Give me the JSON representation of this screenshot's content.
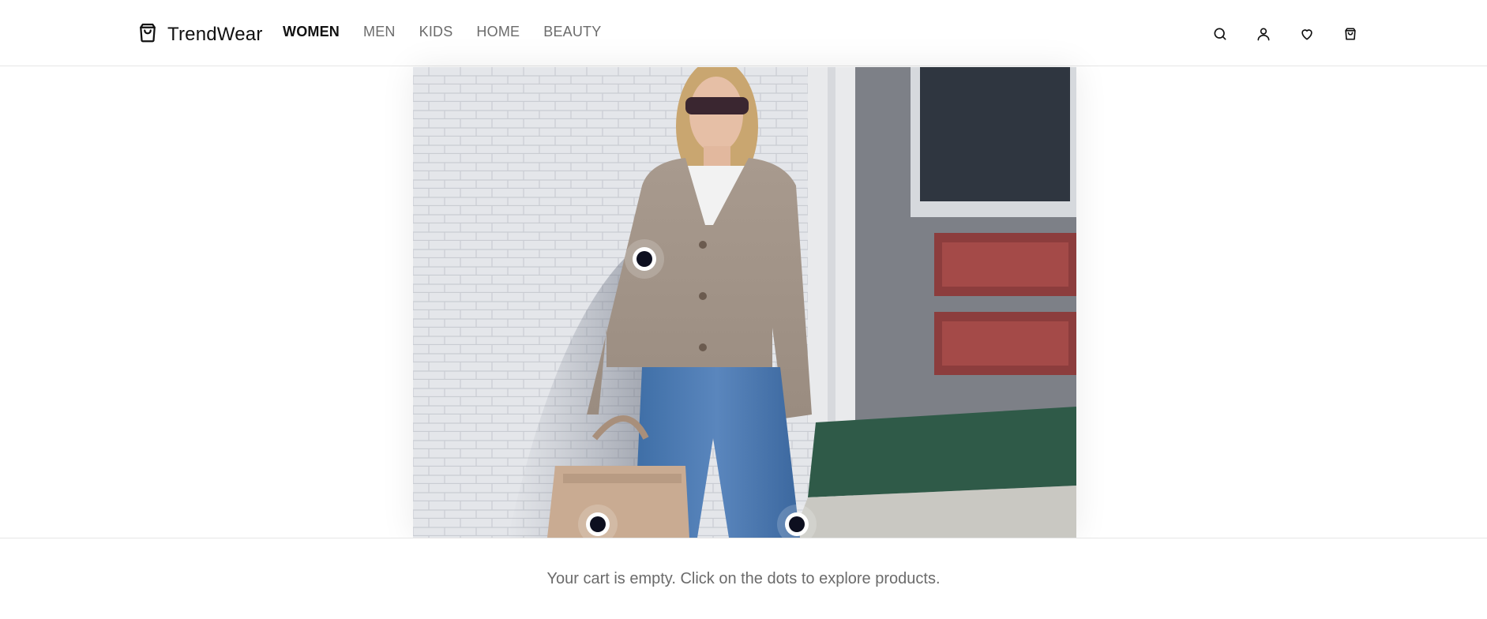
{
  "brand": {
    "name": "TrendWear",
    "logo_icon": "shopping-bag-icon"
  },
  "nav": {
    "items": [
      {
        "label": "WOMEN",
        "active": true
      },
      {
        "label": "MEN",
        "active": false
      },
      {
        "label": "KIDS",
        "active": false
      },
      {
        "label": "HOME",
        "active": false
      },
      {
        "label": "BEAUTY",
        "active": false
      }
    ]
  },
  "header_icons": [
    "search-icon",
    "user-icon",
    "heart-icon",
    "cart-icon"
  ],
  "hero": {
    "image_subject": "woman in knit cardigan, jeans and tan handbag by white brick wall",
    "hotspots": [
      "cardigan",
      "handbag",
      "jeans"
    ]
  },
  "cart": {
    "message": "Your cart is empty. Click on the dots to explore products."
  },
  "colors": {
    "accent": "#111111",
    "hotspot": "#0d0f1f",
    "muted_text": "#6b6b6b"
  }
}
